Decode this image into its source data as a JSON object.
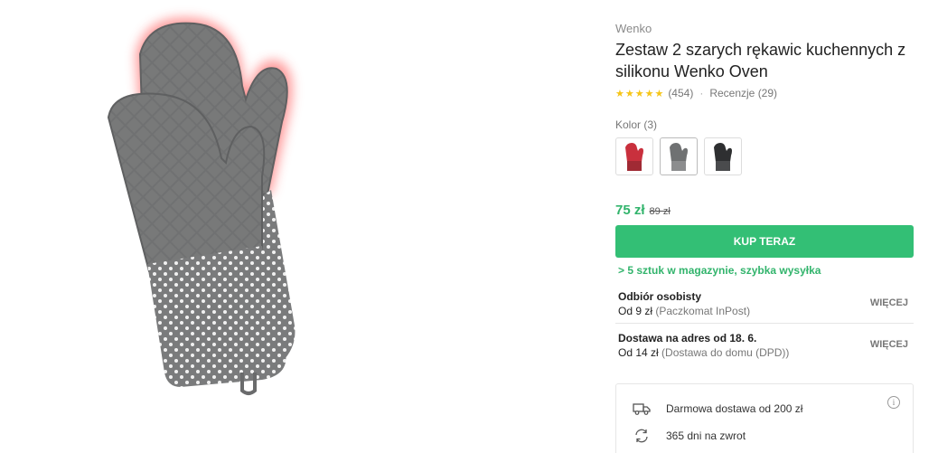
{
  "product": {
    "brand": "Wenko",
    "title": "Zestaw 2 szarych rękawic kuchennych z silikonu Wenko Oven",
    "image_icon": "oven-mitt-image",
    "rating": {
      "stars": "★★★★★",
      "stars_value": 5,
      "count": "(454)",
      "separator": "·",
      "reviews_label": "Recenzje (29)"
    }
  },
  "colors": {
    "label": "Kolor (3)",
    "swatches": [
      {
        "name": "red",
        "color": "#c9303d"
      },
      {
        "name": "grey",
        "color": "#6f7172"
      },
      {
        "name": "black",
        "color": "#2e2f31"
      }
    ]
  },
  "pricing": {
    "price": "75 zł",
    "old_price": "89 zł",
    "price_color": "#32b46c"
  },
  "buy": {
    "label": "KUP TERAZ",
    "color": "#33bf75"
  },
  "stock": "> 5 sztuk w magazynie, szybka wysyłka",
  "delivery": [
    {
      "title": "Odbiór osobisty",
      "price": "Od 9 zł",
      "detail": "(Paczkomat InPost)",
      "more": "WIĘCEJ"
    },
    {
      "title": "Dostawa na adres od 18. 6.",
      "price": "Od 14 zł",
      "detail": "(Dostawa do domu (DPD))",
      "more": "WIĘCEJ"
    }
  ],
  "benefits": [
    {
      "icon": "truck-icon",
      "text": "Darmowa dostawa od 200 zł"
    },
    {
      "icon": "return-icon",
      "text": "365 dni na zwrot"
    }
  ],
  "info_icon": "i"
}
